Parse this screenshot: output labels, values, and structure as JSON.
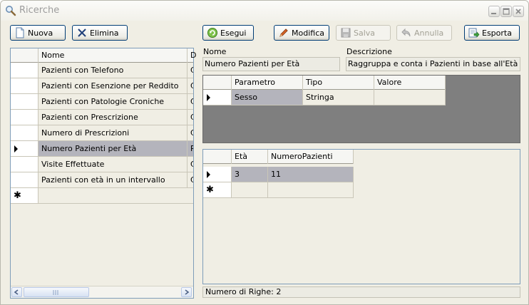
{
  "window": {
    "title": "Ricerche"
  },
  "toolbar": {
    "nuova": "Nuova",
    "elimina": "Elimina",
    "esegui": "Esegui",
    "modifica": "Modifica",
    "salva": "Salva",
    "annulla": "Annulla",
    "esporta": "Esporta"
  },
  "queries": {
    "columns": [
      "Nome",
      "D"
    ],
    "rows": [
      {
        "nome": "Pazienti con Telefono",
        "d": "C"
      },
      {
        "nome": "Pazienti con Esenzione per Reddito",
        "d": "C"
      },
      {
        "nome": "Pazienti con Patologie Croniche",
        "d": "C"
      },
      {
        "nome": "Pazienti con Prescrizione",
        "d": "C"
      },
      {
        "nome": "Numero di Prescrizioni",
        "d": "C"
      },
      {
        "nome": "Numero Pazienti per Età",
        "d": "R"
      },
      {
        "nome": "Visite Effettuate",
        "d": "C"
      },
      {
        "nome": "Pazienti con età in un intervallo",
        "d": "C"
      }
    ],
    "new_row_marker": "✱",
    "selected_index": 5
  },
  "details": {
    "nome_label": "Nome",
    "nome_value": "Numero Pazienti per Età",
    "descrizione_label": "Descrizione",
    "descrizione_value": "Raggruppa e conta i Pazienti in base all'Età"
  },
  "parameters": {
    "columns": [
      "Parametro",
      "Tipo",
      "Valore"
    ],
    "rows": [
      {
        "parametro": "Sesso",
        "tipo": "Stringa",
        "valore": ""
      }
    ]
  },
  "results": {
    "columns": [
      "Età",
      "NumeroPazienti"
    ],
    "rows": [
      {
        "eta": "3",
        "numero": "11"
      }
    ],
    "new_row_marker": "✱"
  },
  "status": {
    "text": "Numero di Righe: 2"
  },
  "colors": {
    "accent_border": "#003c74",
    "selection": "#b4b4bc",
    "empty_grid": "#7f7f7f"
  }
}
